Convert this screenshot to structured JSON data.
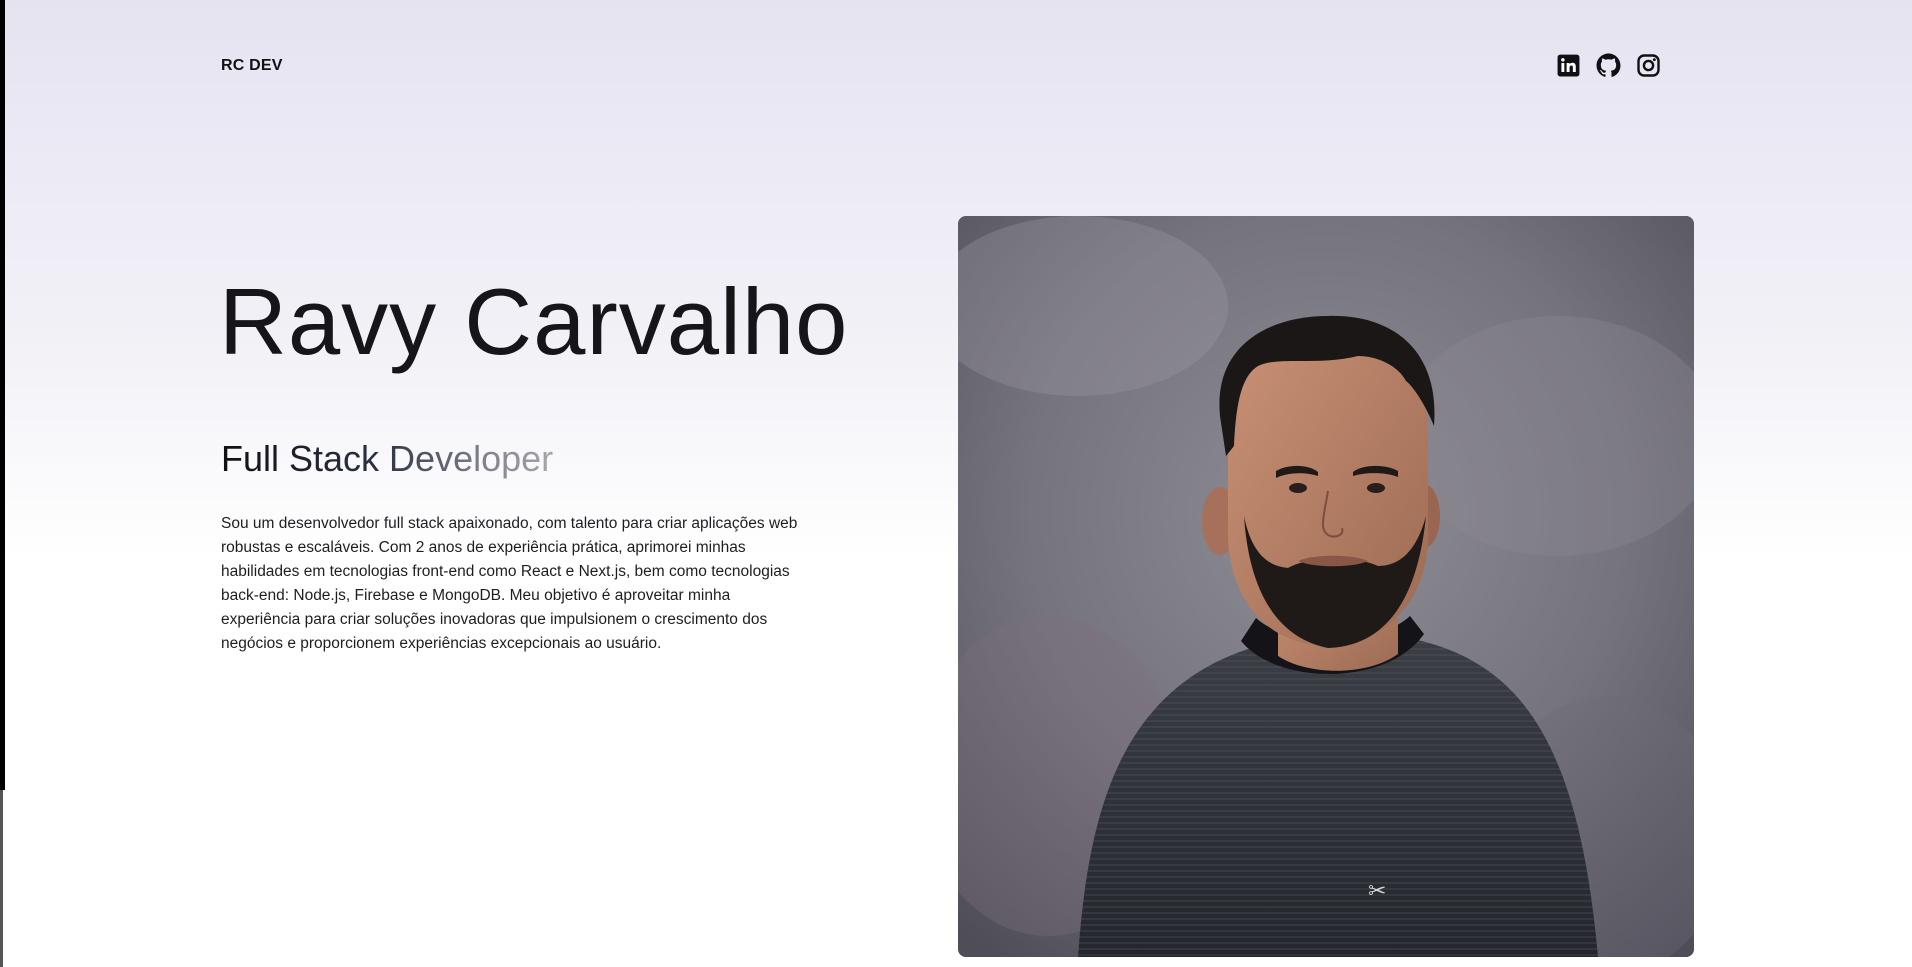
{
  "header": {
    "logo": "RC DEV",
    "socials": [
      {
        "label": "LinkedIn",
        "icon": "linkedin-icon"
      },
      {
        "label": "GitHub",
        "icon": "github-icon"
      },
      {
        "label": "Instagram",
        "icon": "instagram-icon"
      }
    ]
  },
  "hero": {
    "name": "Ravy Carvalho",
    "role": "Full Stack Developer",
    "bio": "Sou um desenvolvedor full stack apaixonado, com talento para criar aplicações web robustas e escaláveis. Com 2 anos de experiência prática, aprimorei minhas habilidades em tecnologias front-end como React e Next.js, bem como tecnologias back-end: Node.js, Firebase e MongoDB. Meu objetivo é aproveitar minha experiência para criar soluções inovadoras que impulsionem o crescimento dos negócios e proporcionem experiências excepcionais ao usuário."
  },
  "photo": {
    "alt": "Ravy Carvalho"
  },
  "colors": {
    "text": "#111114",
    "background_top": "#e6e3f1",
    "background_bottom": "#ffffff",
    "photo_backdrop": "#6e6c74"
  }
}
